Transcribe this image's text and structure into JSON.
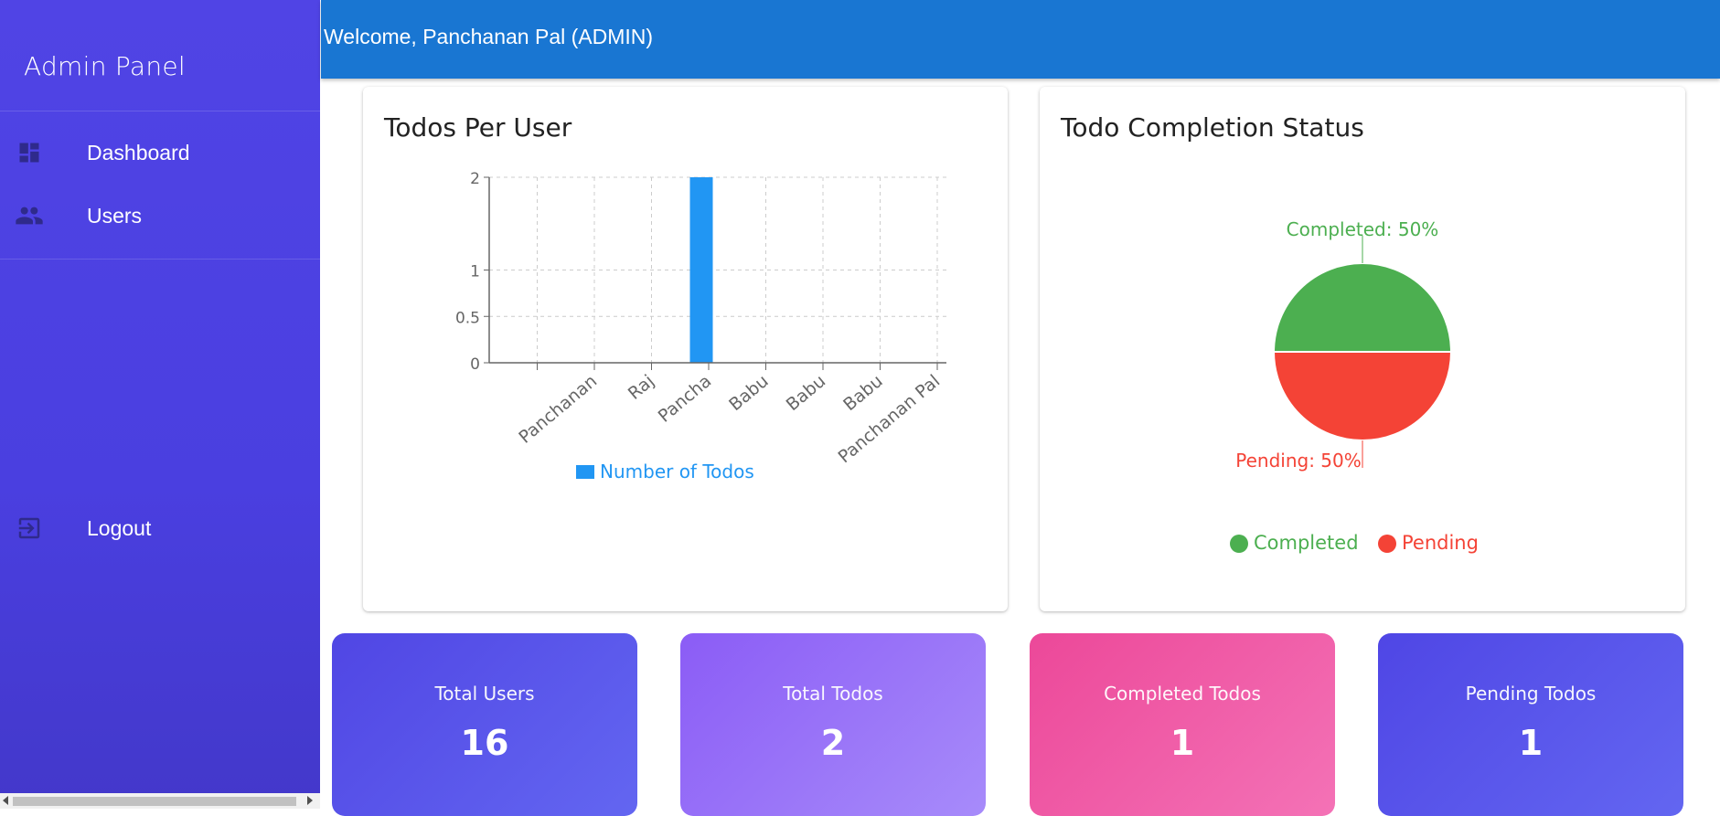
{
  "sidebar": {
    "title": "Admin Panel",
    "items": [
      {
        "label": "Dashboard",
        "icon": "dashboard-icon"
      },
      {
        "label": "Users",
        "icon": "people-icon"
      },
      {
        "label": "Logout",
        "icon": "logout-icon"
      }
    ]
  },
  "header": {
    "welcome": "Welcome, Panchanan Pal (ADMIN)"
  },
  "cards": {
    "bar_title": "Todos Per User",
    "pie_title": "Todo Completion Status"
  },
  "stats": [
    {
      "label": "Total Users",
      "value": "16"
    },
    {
      "label": "Total Todos",
      "value": "2"
    },
    {
      "label": "Completed Todos",
      "value": "1"
    },
    {
      "label": "Pending Todos",
      "value": "1"
    }
  ],
  "colors": {
    "bar": "#2196f3",
    "completed": "#4caf50",
    "pending": "#f44336",
    "header": "#1976d2"
  },
  "chart_data": [
    {
      "type": "bar",
      "title": "Todos Per User",
      "categories": [
        "",
        "Panchanan",
        "Raj",
        "Pancha",
        "Babu",
        "Babu",
        "Babu",
        "Panchanan Pal"
      ],
      "series": [
        {
          "name": "Number of Todos",
          "values": [
            0,
            0,
            0,
            2,
            0,
            0,
            0,
            0
          ]
        }
      ],
      "yticks": [
        "0",
        "0.5",
        "1",
        "2"
      ],
      "ylim": [
        0,
        2
      ],
      "grid": true,
      "legend": "bottom"
    },
    {
      "type": "pie",
      "title": "Todo Completion Status",
      "labels": [
        "Completed",
        "Pending"
      ],
      "values": [
        50,
        50
      ],
      "slice_labels": [
        "Completed: 50%",
        "Pending: 50%"
      ],
      "legend": "bottom"
    }
  ]
}
